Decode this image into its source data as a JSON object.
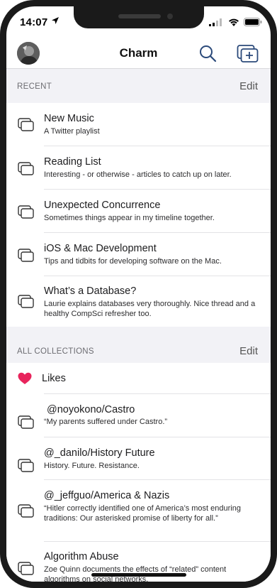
{
  "status_bar": {
    "time": "14:07"
  },
  "nav": {
    "title": "Charm"
  },
  "recent": {
    "label": "RECENT",
    "edit_label": "Edit",
    "items": [
      {
        "title": "New Music",
        "subtitle": "A Twitter playlist"
      },
      {
        "title": "Reading List",
        "subtitle": "Interesting - or otherwise - articles to catch up on later."
      },
      {
        "title": "Unexpected Concurrence",
        "subtitle": "Sometimes things appear in my timeline together."
      },
      {
        "title": "iOS & Mac Development",
        "subtitle": "Tips and tidbits for developing software on the Mac."
      },
      {
        "title": "What’s a Database?",
        "subtitle": "Laurie explains databases very thoroughly. Nice thread and a healthy CompSci refresher too."
      }
    ]
  },
  "all": {
    "label": "ALL COLLECTIONS",
    "edit_label": "Edit",
    "likes_label": "Likes",
    "items": [
      {
        "title": "@noyokono/Castro",
        "subtitle": "“My parents suffered under Castro.”"
      },
      {
        "title": "@_danilo/History Future",
        "subtitle": "History. Future. Resistance."
      },
      {
        "title": "@_jeffguo/America & Nazis",
        "subtitle": "“Hitler correctly identified one of America’s most enduring traditions: Our asterisked promise of liberty for all.”"
      },
      {
        "title": "Algorithm Abuse",
        "subtitle": "Zoe Quinn documents the effects of “related” content algorithms on social networks."
      }
    ]
  },
  "colors": {
    "heart": "#e8245c",
    "accent": "#2b4a7a"
  }
}
